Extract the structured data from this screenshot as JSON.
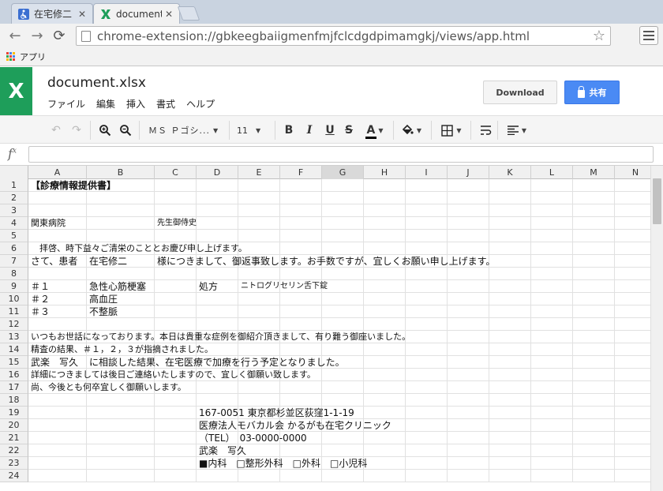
{
  "browser": {
    "tabs": [
      {
        "title": "在宅修二",
        "close": "✕"
      },
      {
        "title": "document",
        "close": "✕"
      }
    ],
    "url": "chrome-extension://gbkeegbaiigmenfmjfclcdgdpimamgkj/views/app.html",
    "bookmarks_label": "アプリ",
    "colors": {
      "brand_green": "#1e9e5a"
    }
  },
  "app": {
    "logo_letter": "X",
    "title": "document.xlsx",
    "menu": [
      "ファイル",
      "編集",
      "挿入",
      "書式",
      "ヘルプ"
    ],
    "download_label": "Download",
    "share_label": "共有",
    "colors": {
      "share": "#4a8af4"
    }
  },
  "toolbar": {
    "font_name": "ＭＳ Ｐゴシ...",
    "font_size": "11",
    "bold": "B",
    "italic": "I",
    "underline": "U",
    "strike": "S",
    "text_color": "A"
  },
  "formula": {
    "fx": "f",
    "fx_sup": "x",
    "value": ""
  },
  "sheet": {
    "columns": [
      "A",
      "B",
      "C",
      "D",
      "E",
      "F",
      "G",
      "H",
      "I",
      "J",
      "K",
      "L",
      "M",
      "N"
    ],
    "selected_column": "G",
    "rows": [
      "1",
      "2",
      "3",
      "4",
      "5",
      "6",
      "7",
      "8",
      "9",
      "10",
      "11",
      "12",
      "13",
      "14",
      "15",
      "16",
      "17",
      "18",
      "19",
      "20",
      "21",
      "22",
      "23",
      "24"
    ],
    "cells": {
      "A1": "【診療情報提供書】",
      "A4": "関東病院",
      "C4": "先生御侍史",
      "A6": "　拝啓、時下益々ご清栄のこととお慶び申し上げます。",
      "A7": "さて、患者",
      "B7": "在宅修二",
      "C7": "様につきまして、御返事致します。お手数ですが、宜しくお願い申し上げます。",
      "A9": "＃１",
      "B9": "急性心筋梗塞",
      "D9": "処方",
      "E9": "ニトログリセリン舌下錠",
      "A10": "＃２",
      "B10": "高血圧",
      "A11": "＃３",
      "B11": "不整脈",
      "A13": "いつもお世話になっております。本日は貴重な症例を御紹介頂きまして、有り難う御座いました。",
      "A14": "精査の結果、＃１，２，３が指摘されました。",
      "A15": "武楽　写久",
      "B15": "に相談した結果、在宅医療で加療を行う予定となりました。",
      "A16": "詳細につきましては後日ご連絡いたしますので、宜しく御願い致します。",
      "A17": "尚、今後とも何卒宜しく御願いします。",
      "D19": "167-0051 東京都杉並区荻窪1-1-19",
      "D20": "医療法人モバカル会 かるがも在宅クリニック",
      "D21": "（TEL）　03-0000-0000",
      "D22": "武楽　写久",
      "D23": "■内科　□整形外科　□外科　□小児科"
    }
  }
}
